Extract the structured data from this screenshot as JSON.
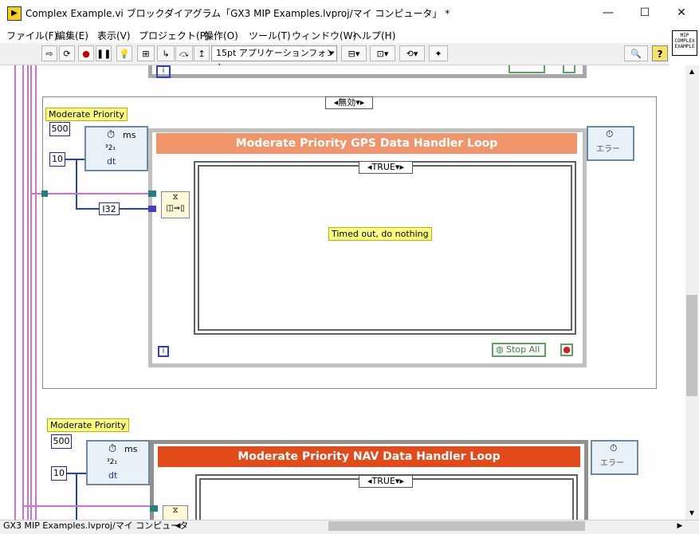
{
  "window": {
    "title": "Complex Example.vi ブロックダイアグラム「GX3 MIP Examples.lvproj/マイ コンピュータ」 *",
    "minimize": "—",
    "maximize": "☐",
    "close": "✕"
  },
  "menu": {
    "items": [
      "ファイル(F)",
      "編集(E)",
      "表示(V)",
      "プロジェクト(P)",
      "操作(O)",
      "ツール(T)",
      "ウィンドウ(W)",
      "ヘルプ(H)"
    ]
  },
  "toolbar": {
    "font_label": "15pt アプリケーションフォント",
    "help": "?"
  },
  "vi_icon": {
    "lines": [
      "MIP",
      "COMPLEX",
      "EXAMPLE"
    ]
  },
  "diagram": {
    "disable_selector": "無効",
    "gps": {
      "priority_label": "Moderate Priority",
      "const_500": "500",
      "const_10": "10",
      "ms_label": "ms",
      "dt_label": "dt",
      "count_label": "³2₁",
      "i32_label": "I32",
      "loop_title": "Moderate Priority GPS Data Handler Loop",
      "case_value": "TRUE",
      "timeout_text": "Timed out, do nothing",
      "stop_all": "Stop All",
      "iteration": "i",
      "error_label": "エラー"
    },
    "nav": {
      "priority_label": "Moderate Priority",
      "const_500": "500",
      "const_10": "10",
      "ms_label": "ms",
      "dt_label": "dt",
      "count_label": "³2₁",
      "loop_title": "Moderate Priority NAV Data Handler Loop",
      "case_value": "TRUE",
      "error_label": "エラー"
    }
  },
  "status": {
    "text": "GX3 MIP Examples.lvproj/マイ コンピュータ"
  },
  "colors": {
    "gps_header": "#f0956a",
    "nav_header": "#e24a1a",
    "label_bg": "#ffff80",
    "wire_pink": "#d070d0",
    "wire_blue": "#2040d0"
  }
}
